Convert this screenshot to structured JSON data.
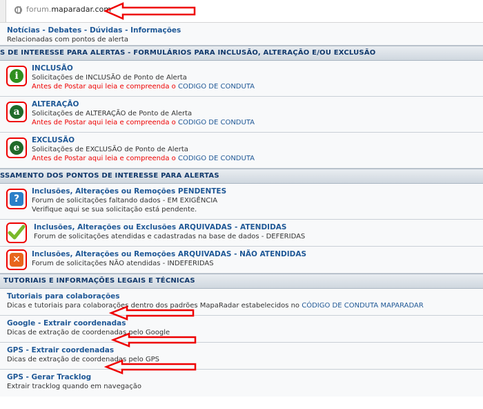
{
  "browser": {
    "url_prefix": "forum.",
    "url_domain": "maparadar.com"
  },
  "colors": {
    "link": "#1f5896",
    "warning": "#ee0000",
    "annotation_arrow": "#e00000"
  },
  "top_forum": {
    "title": "Notícias - Debates - Dúvidas - Informações",
    "description": "Relacionadas com pontos de alerta"
  },
  "section1": {
    "title": "S DE INTERESSE PARA ALERTAS - FORMULÁRIOS PARA INCLUSÃO, ALTERAÇÃO E/OU EXCLUSÃO"
  },
  "forms": [
    {
      "icon": "info-i-icon",
      "letter": "i",
      "title": "INCLUSÃO",
      "description": "Solicitações de INCLUSÃO de Ponto de Alerta",
      "warning": "Antes de Postar aqui leia e compreenda o ",
      "link": "CODIGO DE CONDUTA"
    },
    {
      "icon": "letter-a-icon",
      "letter": "a",
      "title": "ALTERAÇÃO",
      "description": "Solicitações de ALTERAÇÃO de Ponto de Alerta",
      "warning": "Antes de Postar aqui leia e compreenda o ",
      "link": "CODIGO DE CONDUTA"
    },
    {
      "icon": "letter-e-icon",
      "letter": "e",
      "title": "EXCLUSÃO",
      "description": "Solicitações de EXCLUSÃO de Ponto de Alerta",
      "warning": "Antes de Postar aqui leia e compreenda o ",
      "link": "CODIGO DE CONDUTA"
    }
  ],
  "section2": {
    "title": "SSAMENTO DOS PONTOS DE INTERESSE PARA ALERTAS"
  },
  "processing": [
    {
      "title": "Inclusões, Alterações ou Remoções PENDENTES",
      "description": "Forum de solicitações faltando dados - EM EXIGÊNCIA",
      "description2": "Verifique aqui se sua solicitação está pendente."
    },
    {
      "title": "Inclusões, Alterações ou Exclusões ARQUIVADAS - ATENDIDAS",
      "description": "Forum de solicitações atendidas e cadastradas na base de dados - DEFERIDAS"
    },
    {
      "title": "Inclusões, Alterações ou Remoções ARQUIVADAS - NÃO ATENDIDAS",
      "description": "Forum de solicitações NÃO atendidas - INDEFERIDAS"
    }
  ],
  "section3": {
    "title": "TUTORIAIS E INFORMAÇÕES LEGAIS E TÉCNICAS"
  },
  "tutorials": [
    {
      "title": "Tutoriais para colaborações",
      "description": "Dicas e tutoriais para colaborações dentro dos padrões MapaRadar estabelecidos no ",
      "link": "CÓDIGO DE CONDUTA MAPARADAR"
    },
    {
      "title": "Google - Extrair coordenadas",
      "description": "Dicas de extração de coordenadas pelo Google"
    },
    {
      "title": "GPS - Extrair coordenadas",
      "description": "Dicas de extração de coordenadas pelo GPS"
    },
    {
      "title": "GPS - Gerar Tracklog",
      "description": "Extrair tracklog quando em navegação"
    }
  ]
}
